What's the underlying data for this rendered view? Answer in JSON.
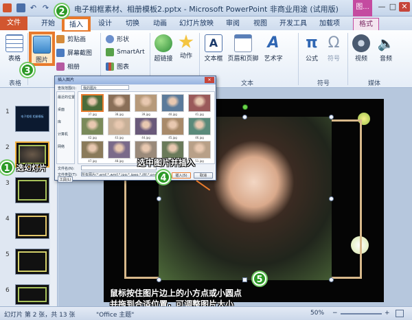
{
  "window": {
    "title": "电子相框素材、相册模板2.pptx - Microsoft PowerPoint 非商业用途 (试用版)",
    "context_tab_top": "图...",
    "minimize": "—",
    "maximize": "□",
    "close": "✕"
  },
  "tabs": {
    "file": "文件",
    "home": "开始",
    "insert": "插入",
    "design": "设计",
    "transitions": "切换",
    "animations": "动画",
    "slideshow": "幻灯片放映",
    "review": "审阅",
    "view": "视图",
    "developer": "开发工具",
    "addins": "加载项",
    "format": "格式"
  },
  "ribbon": {
    "table": "表格",
    "picture": "图片",
    "clipart": "剪贴画",
    "screenshot": "屏幕截图",
    "album": "相册",
    "shapes": "形状",
    "smartart": "SmartArt",
    "chart": "图表",
    "hyperlink": "超链接",
    "action": "动作",
    "textbox": "文本框",
    "headerfooter": "页眉和页脚",
    "wordart": "艺术字",
    "equation": "公式",
    "symbol": "符号",
    "video": "视频",
    "audio": "音频",
    "groups": {
      "tables": "表格",
      "text": "文本",
      "symbols": "符号",
      "media": "媒体"
    }
  },
  "thumbnails": {
    "numbers": [
      "1",
      "2",
      "3",
      "4",
      "5",
      "6"
    ],
    "slide1_text": "电子相框 相册模板"
  },
  "dialog": {
    "title": "插入图片",
    "location_label": "查找范围(I):",
    "location_value": "我的图片",
    "side_items": [
      "最近的位置",
      "桌面",
      "库",
      "计算机",
      "网络"
    ],
    "file_labels": [
      "37.jpg",
      "38.jpg",
      "39.jpg",
      "40.jpg",
      "41.jpg",
      "42.jpg",
      "43.jpg",
      "44.jpg",
      "45.jpg",
      "46.jpg",
      "47.jpg",
      "48.jpg",
      "49.jpg",
      "50.jpg",
      "51.jpg"
    ],
    "filename_label": "文件名(N):",
    "filetype_label": "文件类型(T):",
    "filetype_value": "所有图片(*.emf;*.wmf;*.jpg;*.jpeg;*.jfif;*.png)",
    "tools": "工具(L)",
    "insert": "插入(S)",
    "cancel": "取消"
  },
  "annotations": {
    "step1": "1",
    "step2": "2",
    "step3": "3",
    "step4": "4",
    "step5": "5",
    "select_slide": "选幻灯片",
    "select_insert": "选中图片并插入",
    "resize_line1": "鼠标按住图片边上的小方点或小圆点",
    "resize_line2": "并拖到合适位置，可调整图片大小"
  },
  "status": {
    "slide_info": "幻灯片 第 2 张，共 13 张",
    "theme": "\"Office 主题\"",
    "zoom": "50%",
    "zoom_minus": "−",
    "zoom_plus": "+"
  },
  "colors": {
    "accent": "#e87a2c",
    "file_tab": "#d2562f",
    "step_green": "#2c9a26",
    "context_tab": "#c44ba0"
  }
}
